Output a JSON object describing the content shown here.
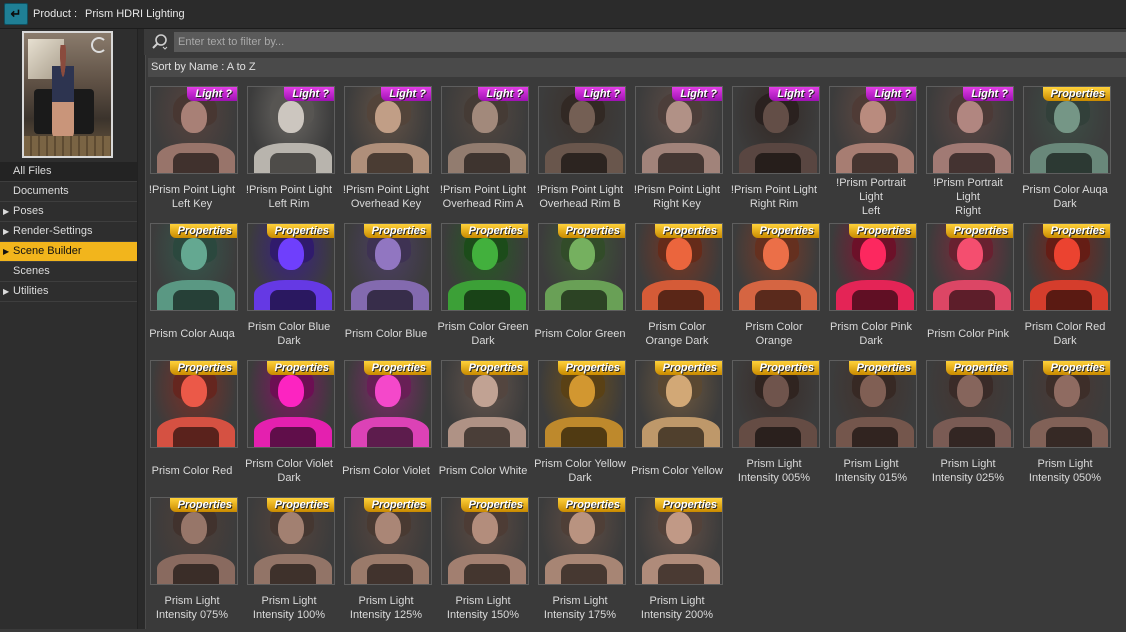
{
  "titlebar": {
    "label": "Product :",
    "product": "Prism HDRI Lighting"
  },
  "sidebar": {
    "items": [
      {
        "label": "All Files",
        "arrow": false
      },
      {
        "label": "Documents",
        "arrow": false
      },
      {
        "label": "Poses",
        "arrow": true
      },
      {
        "label": "Render-Settings",
        "arrow": true
      },
      {
        "label": "Scene Builder",
        "arrow": true,
        "selected": true
      },
      {
        "label": "Scenes",
        "arrow": false
      },
      {
        "label": "Utilities",
        "arrow": true
      }
    ]
  },
  "search": {
    "placeholder": "Enter text to filter by..."
  },
  "sort": {
    "label": "Sort by Name : A to Z"
  },
  "badges": {
    "light": "Light ?",
    "props": "Properties"
  },
  "items": [
    {
      "l1": "!Prism Point Light",
      "l2": "Left Key",
      "badge": "light",
      "tint": "#a07a70"
    },
    {
      "l1": "!Prism Point Light",
      "l2": "Left Rim",
      "badge": "light",
      "tint": "#c2bdb6"
    },
    {
      "l1": "!Prism Point Light",
      "l2": "Overhead Key",
      "badge": "light",
      "tint": "#b89680"
    },
    {
      "l1": "!Prism Point Light",
      "l2": "Overhead Rim A",
      "badge": "light",
      "tint": "#9a8275"
    },
    {
      "l1": "!Prism Point Light",
      "l2": "Overhead Rim B",
      "badge": "light",
      "tint": "#6e5a50"
    },
    {
      "l1": "!Prism Point Light",
      "l2": "Right Key",
      "badge": "light",
      "tint": "#a98a80"
    },
    {
      "l1": "!Prism Point Light",
      "l2": "Right Rim",
      "badge": "light",
      "tint": "#5e4a44"
    },
    {
      "l1": "!Prism Portrait Light",
      "l2": "Left",
      "badge": "light",
      "tint": "#b08478"
    },
    {
      "l1": "!Prism Portrait Light",
      "l2": "Right",
      "badge": "light",
      "tint": "#a9807a"
    },
    {
      "l1": "Prism Color Auqa",
      "l2": "Dark",
      "badge": "props",
      "tint": "#6f8f80"
    },
    {
      "l1": "Prism Color Auqa",
      "l2": "",
      "badge": "props",
      "tint": "#5fa08a"
    },
    {
      "l1": "Prism Color Blue",
      "l2": "Dark",
      "badge": "props",
      "tint": "#6a3cf0"
    },
    {
      "l1": "Prism Color Blue",
      "l2": "",
      "badge": "props",
      "tint": "#8a70b8"
    },
    {
      "l1": "Prism Color Green",
      "l2": "Dark",
      "badge": "props",
      "tint": "#3fa83a"
    },
    {
      "l1": "Prism Color Green",
      "l2": "",
      "badge": "props",
      "tint": "#6fa85a"
    },
    {
      "l1": "Prism Color",
      "l2": "Orange Dark",
      "badge": "props",
      "tint": "#e0603a"
    },
    {
      "l1": "Prism Color",
      "l2": "Orange",
      "badge": "props",
      "tint": "#e06a45"
    },
    {
      "l1": "Prism Color Pink",
      "l2": "Dark",
      "badge": "props",
      "tint": "#f0265a"
    },
    {
      "l1": "Prism Color Pink",
      "l2": "",
      "badge": "props",
      "tint": "#e84a6a"
    },
    {
      "l1": "Prism Color Red",
      "l2": "Dark",
      "badge": "props",
      "tint": "#e0402e"
    },
    {
      "l1": "Prism Color Red",
      "l2": "",
      "badge": "props",
      "tint": "#e05545"
    },
    {
      "l1": "Prism Color Violet",
      "l2": "Dark",
      "badge": "props",
      "tint": "#f022b8"
    },
    {
      "l1": "Prism Color Violet",
      "l2": "",
      "badge": "props",
      "tint": "#e845c0"
    },
    {
      "l1": "Prism Color White",
      "l2": "",
      "badge": "props",
      "tint": "#b89a8c"
    },
    {
      "l1": "Prism Color Yellow",
      "l2": "Dark",
      "badge": "props",
      "tint": "#c8902e"
    },
    {
      "l1": "Prism Color Yellow",
      "l2": "",
      "badge": "props",
      "tint": "#c8a070"
    },
    {
      "l1": "Prism Light",
      "l2": "Intensity 005%",
      "badge": "props",
      "tint": "#6a5048"
    },
    {
      "l1": "Prism Light",
      "l2": "Intensity 015%",
      "badge": "props",
      "tint": "#7a5a50"
    },
    {
      "l1": "Prism Light",
      "l2": "Intensity 025%",
      "badge": "props",
      "tint": "#806058"
    },
    {
      "l1": "Prism Light",
      "l2": "Intensity 050%",
      "badge": "props",
      "tint": "#88665c"
    },
    {
      "l1": "Prism Light",
      "l2": "Intensity 075%",
      "badge": "props",
      "tint": "#907064"
    },
    {
      "l1": "Prism Light",
      "l2": "Intensity 100%",
      "badge": "props",
      "tint": "#9a7a6c"
    },
    {
      "l1": "Prism Light",
      "l2": "Intensity 125%",
      "badge": "props",
      "tint": "#a28070"
    },
    {
      "l1": "Prism Light",
      "l2": "Intensity 150%",
      "badge": "props",
      "tint": "#aa8676"
    },
    {
      "l1": "Prism Light",
      "l2": "Intensity 175%",
      "badge": "props",
      "tint": "#b08c7a"
    },
    {
      "l1": "Prism Light",
      "l2": "Intensity 200%",
      "badge": "props",
      "tint": "#b89280"
    }
  ]
}
